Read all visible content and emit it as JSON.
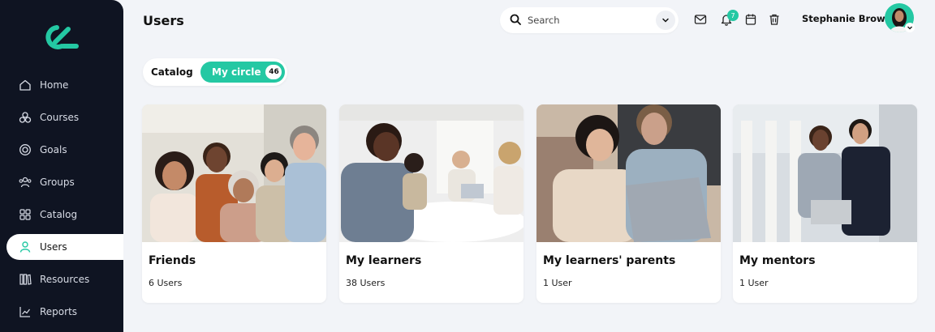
{
  "colors": {
    "accent": "#24c8a3",
    "sidebar_bg": "#0f1422",
    "page_bg": "#f2f4f8"
  },
  "sidebar": {
    "items": [
      {
        "label": "Home",
        "icon": "home-icon"
      },
      {
        "label": "Courses",
        "icon": "courses-icon"
      },
      {
        "label": "Goals",
        "icon": "goals-icon"
      },
      {
        "label": "Groups",
        "icon": "groups-icon"
      },
      {
        "label": "Catalog",
        "icon": "catalog-icon"
      },
      {
        "label": "Users",
        "icon": "user-icon",
        "active": true
      },
      {
        "label": "Resources",
        "icon": "resources-icon"
      },
      {
        "label": "Reports",
        "icon": "reports-icon"
      }
    ]
  },
  "header": {
    "title": "Users",
    "search_placeholder": "Search",
    "notification_count": "7",
    "user_name": "Stephanie Brown"
  },
  "tabs": {
    "catalog_label": "Catalog",
    "circle_label": "My circle",
    "circle_count": "46"
  },
  "cards": [
    {
      "title": "Friends",
      "count": "6 Users"
    },
    {
      "title": "My learners",
      "count": "38 Users"
    },
    {
      "title": "My learners' parents",
      "count": "1 User"
    },
    {
      "title": "My mentors",
      "count": "1 User"
    }
  ]
}
